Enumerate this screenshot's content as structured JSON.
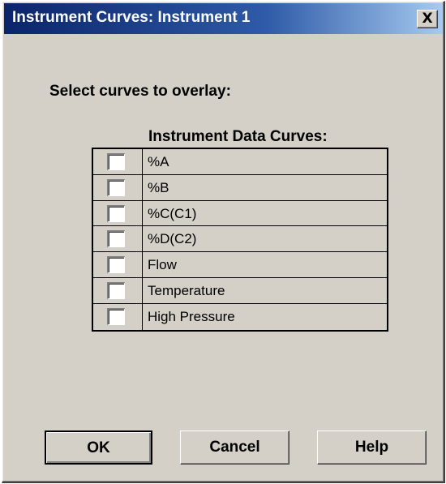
{
  "window": {
    "title": "Instrument Curves: Instrument 1",
    "close_label": "X"
  },
  "prompt": "Select curves to overlay:",
  "curves": {
    "header": "Instrument Data Curves:",
    "items": [
      {
        "label": "%A",
        "checked": false
      },
      {
        "label": "%B",
        "checked": false
      },
      {
        "label": "%C(C1)",
        "checked": false
      },
      {
        "label": "%D(C2)",
        "checked": false
      },
      {
        "label": "Flow",
        "checked": false
      },
      {
        "label": "Temperature",
        "checked": false
      },
      {
        "label": "High Pressure",
        "checked": false
      }
    ]
  },
  "buttons": {
    "ok": "OK",
    "cancel": "Cancel",
    "help": "Help"
  },
  "colors": {
    "dialog_face": "#d4d0c8",
    "title_start": "#0a246a",
    "title_end": "#a6caf0"
  }
}
